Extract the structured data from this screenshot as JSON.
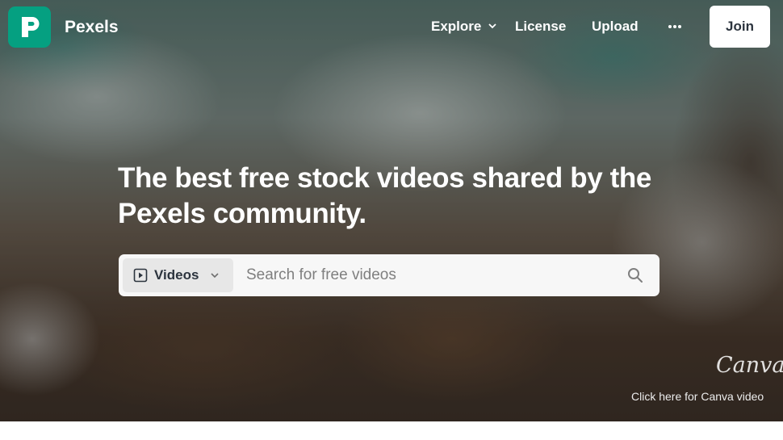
{
  "brand": {
    "name": "Pexels",
    "logo_color": "#05a081"
  },
  "nav": {
    "explore_label": "Explore",
    "license_label": "License",
    "upload_label": "Upload",
    "join_label": "Join"
  },
  "hero": {
    "headline": "The best free stock videos shared by the Pexels community."
  },
  "search": {
    "type_label": "Videos",
    "placeholder": "Search for free videos"
  },
  "canva": {
    "logo_text": "Canva",
    "link_label": "Click here for Canva video"
  },
  "icons": {
    "logo": "pexels-logo-icon",
    "explore_chevron": "chevron-down-icon",
    "more": "more-dots-icon",
    "video_type": "play-square-icon",
    "type_chevron": "chevron-down-icon",
    "search": "search-icon"
  }
}
